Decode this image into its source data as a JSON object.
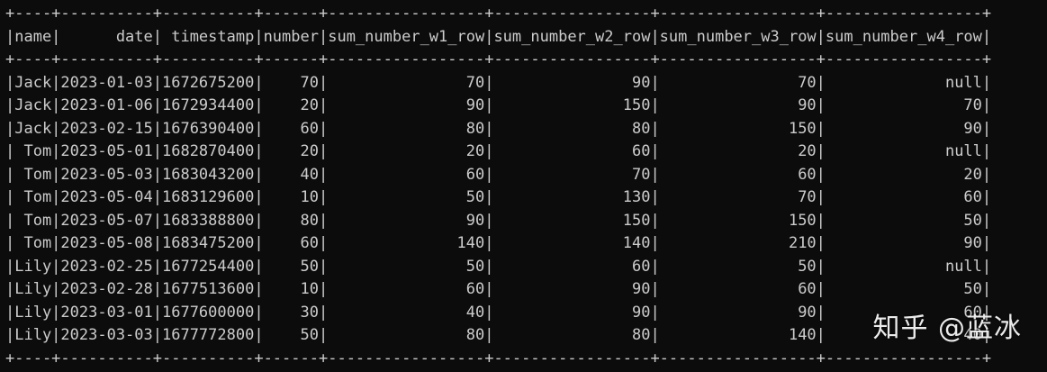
{
  "terminal": {
    "lines": [
      "+----+----------+----------+------+-----------------+-----------------+-----------------+-----------------+",
      "|name|      date| timestamp|number|sum_number_w1_row|sum_number_w2_row|sum_number_w3_row|sum_number_w4_row|",
      "+----+----------+----------+------+-----------------+-----------------+-----------------+-----------------+",
      "|Jack|2023-01-03|1672675200|    70|               70|               90|               70|             null|",
      "|Jack|2023-01-06|1672934400|    20|               90|              150|               90|               70|",
      "|Jack|2023-02-15|1676390400|    60|               80|               80|              150|               90|",
      "| Tom|2023-05-01|1682870400|    20|               20|               60|               20|             null|",
      "| Tom|2023-05-03|1683043200|    40|               60|               70|               60|               20|",
      "| Tom|2023-05-04|1683129600|    10|               50|              130|               70|               60|",
      "| Tom|2023-05-07|1683388800|    80|               90|              150|              150|               50|",
      "| Tom|2023-05-08|1683475200|    60|              140|              140|              210|               90|",
      "|Lily|2023-02-25|1677254400|    50|               50|               60|               50|             null|",
      "|Lily|2023-02-28|1677513600|    10|               60|               90|               60|               50|",
      "|Lily|2023-03-01|1677600000|    30|               40|               90|               90|               60|",
      "|Lily|2023-03-03|1677772800|    50|               80|               80|              140|               40|",
      "+----+----------+----------+------+-----------------+-----------------+-----------------+-----------------+"
    ]
  },
  "watermark": {
    "text": "知乎 @蓝冰"
  },
  "colors": {
    "background": "#0c0c0c",
    "text": "#cccccc"
  }
}
